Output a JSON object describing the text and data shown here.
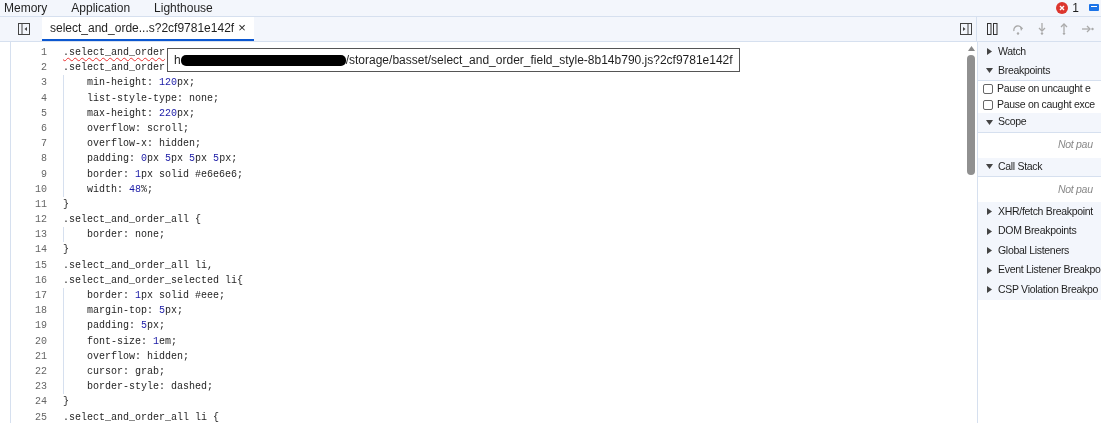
{
  "top_tabs": [
    {
      "label": "Memory"
    },
    {
      "label": "Application"
    },
    {
      "label": "Lighthouse"
    }
  ],
  "status": {
    "errors": "1"
  },
  "file_tab": {
    "label": "select_and_orde...s?2cf9781e142f",
    "close": "×",
    "selected": true
  },
  "tooltip": {
    "prefix": "h",
    "suffix": "/storage/basset/select_and_order_field_style-8b14b790.js?2cf9781e142f"
  },
  "code_lines": [
    {
      "number": "1",
      "tokens": [
        {
          "text": ".select_and_order",
          "kind": "error"
        }
      ]
    },
    {
      "number": "2",
      "tokens": [
        {
          "text": ".select_and_order",
          "kind": "plain"
        }
      ]
    },
    {
      "number": "3",
      "indent": true,
      "tokens": [
        {
          "text": "min-height: ",
          "kind": "plain"
        },
        {
          "text": "120",
          "kind": "num"
        },
        {
          "text": "px;",
          "kind": "plain"
        }
      ]
    },
    {
      "number": "4",
      "indent": true,
      "tokens": [
        {
          "text": "list-style-type: none;",
          "kind": "plain"
        }
      ]
    },
    {
      "number": "5",
      "indent": true,
      "tokens": [
        {
          "text": "max-height: ",
          "kind": "plain"
        },
        {
          "text": "220",
          "kind": "num"
        },
        {
          "text": "px;",
          "kind": "plain"
        }
      ]
    },
    {
      "number": "6",
      "indent": true,
      "tokens": [
        {
          "text": "overflow: scroll;",
          "kind": "plain"
        }
      ]
    },
    {
      "number": "7",
      "indent": true,
      "tokens": [
        {
          "text": "overflow-x: hidden;",
          "kind": "plain"
        }
      ]
    },
    {
      "number": "8",
      "indent": true,
      "tokens": [
        {
          "text": "padding: ",
          "kind": "plain"
        },
        {
          "text": "0",
          "kind": "num"
        },
        {
          "text": "px ",
          "kind": "plain"
        },
        {
          "text": "5",
          "kind": "num"
        },
        {
          "text": "px ",
          "kind": "plain"
        },
        {
          "text": "5",
          "kind": "num"
        },
        {
          "text": "px ",
          "kind": "plain"
        },
        {
          "text": "5",
          "kind": "num"
        },
        {
          "text": "px;",
          "kind": "plain"
        }
      ]
    },
    {
      "number": "9",
      "indent": true,
      "tokens": [
        {
          "text": "border: ",
          "kind": "plain"
        },
        {
          "text": "1",
          "kind": "num"
        },
        {
          "text": "px solid #e6e6e6;",
          "kind": "plain"
        }
      ]
    },
    {
      "number": "10",
      "indent": true,
      "tokens": [
        {
          "text": "width: ",
          "kind": "plain"
        },
        {
          "text": "48",
          "kind": "num"
        },
        {
          "text": "%;",
          "kind": "plain"
        }
      ]
    },
    {
      "number": "11",
      "tokens": [
        {
          "text": "}",
          "kind": "plain"
        }
      ]
    },
    {
      "number": "12",
      "tokens": [
        {
          "text": ".select_and_order_all {",
          "kind": "plain"
        }
      ]
    },
    {
      "number": "13",
      "indent": true,
      "tokens": [
        {
          "text": "border: none;",
          "kind": "plain"
        }
      ]
    },
    {
      "number": "14",
      "tokens": [
        {
          "text": "}",
          "kind": "plain"
        }
      ]
    },
    {
      "number": "15",
      "tokens": [
        {
          "text": ".select_and_order_all li,",
          "kind": "plain"
        }
      ]
    },
    {
      "number": "16",
      "tokens": [
        {
          "text": ".select_and_order_selected li{",
          "kind": "plain"
        }
      ]
    },
    {
      "number": "17",
      "indent": true,
      "tokens": [
        {
          "text": "border: ",
          "kind": "plain"
        },
        {
          "text": "1",
          "kind": "num"
        },
        {
          "text": "px solid #eee;",
          "kind": "plain"
        }
      ]
    },
    {
      "number": "18",
      "indent": true,
      "tokens": [
        {
          "text": "margin-top: ",
          "kind": "plain"
        },
        {
          "text": "5",
          "kind": "num"
        },
        {
          "text": "px;",
          "kind": "plain"
        }
      ]
    },
    {
      "number": "19",
      "indent": true,
      "tokens": [
        {
          "text": "padding: ",
          "kind": "plain"
        },
        {
          "text": "5",
          "kind": "num"
        },
        {
          "text": "px;",
          "kind": "plain"
        }
      ]
    },
    {
      "number": "20",
      "indent": true,
      "tokens": [
        {
          "text": "font-size: ",
          "kind": "plain"
        },
        {
          "text": "1",
          "kind": "num"
        },
        {
          "text": "em;",
          "kind": "plain"
        }
      ]
    },
    {
      "number": "21",
      "indent": true,
      "tokens": [
        {
          "text": "overflow: hidden;",
          "kind": "plain"
        }
      ]
    },
    {
      "number": "22",
      "indent": true,
      "tokens": [
        {
          "text": "cursor: grab;",
          "kind": "plain"
        }
      ]
    },
    {
      "number": "23",
      "indent": true,
      "tokens": [
        {
          "text": "border-style: dashed;",
          "kind": "plain"
        }
      ]
    },
    {
      "number": "24",
      "tokens": [
        {
          "text": "}",
          "kind": "plain"
        }
      ]
    },
    {
      "number": "25",
      "tokens": [
        {
          "text": ".select_and_order_all li {",
          "kind": "plain"
        }
      ]
    }
  ],
  "sections": [
    {
      "kind": "header",
      "label": "Watch",
      "expanded": false
    },
    {
      "kind": "header",
      "label": "Breakpoints",
      "expanded": true
    },
    {
      "kind": "checkbox",
      "label": "Pause on uncaught e",
      "checked": false
    },
    {
      "kind": "checkbox",
      "label": "Pause on caught exce",
      "checked": false
    },
    {
      "kind": "header",
      "label": "Scope",
      "expanded": true
    },
    {
      "kind": "note",
      "label": "Not pau"
    },
    {
      "kind": "header",
      "label": "Call Stack",
      "expanded": true
    },
    {
      "kind": "note",
      "label": "Not pau"
    },
    {
      "kind": "header",
      "label": "XHR/fetch Breakpoint",
      "expanded": false
    },
    {
      "kind": "header",
      "label": "DOM Breakpoints",
      "expanded": false
    },
    {
      "kind": "header",
      "label": "Global Listeners",
      "expanded": false
    },
    {
      "kind": "header",
      "label": "Event Listener Breakpo",
      "expanded": false
    },
    {
      "kind": "header",
      "label": "CSP Violation Breakpo",
      "expanded": false
    }
  ]
}
